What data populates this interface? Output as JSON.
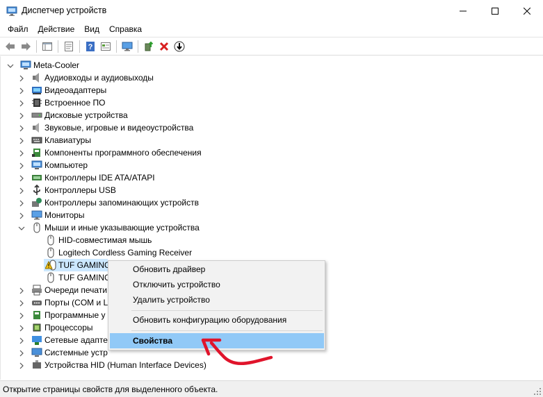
{
  "window": {
    "title": "Диспетчер устройств",
    "icon": "device-manager-icon"
  },
  "menu": [
    "Файл",
    "Действие",
    "Вид",
    "Справка"
  ],
  "toolbar": {
    "buttons": [
      "back-icon",
      "forward-icon",
      "show-hide-tree-icon",
      "properties-icon",
      "help-icon",
      "view-icon",
      "monitor-icon",
      "update-driver-icon",
      "uninstall-icon",
      "scan-icon"
    ]
  },
  "tree": {
    "root": "Meta-Cooler",
    "categories": [
      "Аудиовходы и аудиовыходы",
      "Видеоадаптеры",
      "Встроенное ПО",
      "Дисковые устройства",
      "Звуковые, игровые и видеоустройства",
      "Клавиатуры",
      "Компоненты программного обеспечения",
      "Компьютер",
      "Контроллеры IDE ATA/ATAPI",
      "Контроллеры USB",
      "Контроллеры запоминающих устройств",
      "Мониторы",
      "Мыши и иные указывающие устройства"
    ],
    "mice_children": [
      "HID-совместимая мышь",
      "Logitech Cordless Gaming Receiver",
      "TUF GAMING",
      "TUF GAMING"
    ],
    "categories_after": [
      "Очереди печати",
      "Порты (COM и L",
      "Программные у",
      "Процессоры",
      "Сетевые адаптер",
      "Системные устр",
      "Устройства HID (Human Interface Devices)"
    ]
  },
  "context_menu": {
    "items": [
      "Обновить драйвер",
      "Отключить устройство",
      "Удалить устройство",
      "Обновить конфигурацию оборудования",
      "Свойства"
    ]
  },
  "status": {
    "text": "Открытие страницы свойств для выделенного объекта."
  },
  "colors": {
    "selection": "#cce8ff",
    "context_highlight": "#91c9f7",
    "annotation_arrow": "#e0142b"
  }
}
